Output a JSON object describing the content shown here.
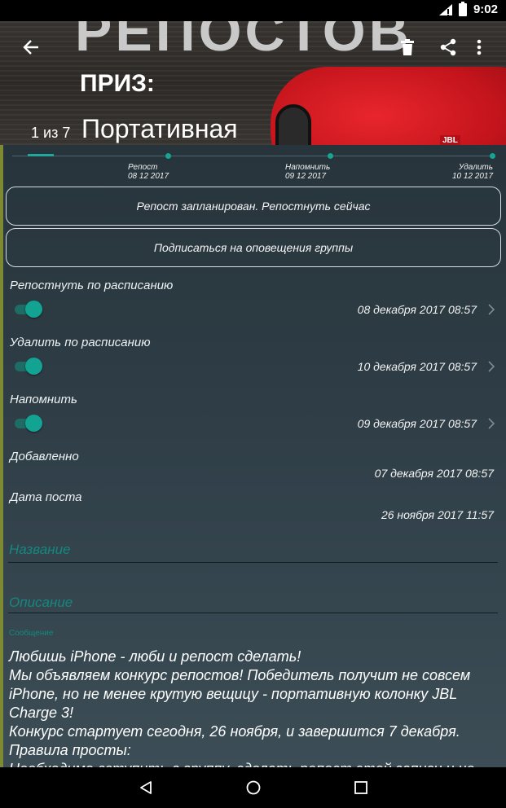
{
  "status_bar": {
    "time": "9:02"
  },
  "header": {
    "image_text_big": "РЕПОСТОВ",
    "image_text_prize": "ПРИЗ:",
    "image_text_sub": "Портативная",
    "counter": "1 из 7",
    "speaker_logo": "JBL",
    "icons": [
      "back-arrow-icon",
      "trash-icon",
      "share-icon",
      "more-vert-icon"
    ]
  },
  "timeline": {
    "progress": 0.05,
    "stages": [
      {
        "label": "Репост",
        "date": "08 12 2017"
      },
      {
        "label": "Напомнить",
        "date": "09 12 2017"
      },
      {
        "label": "Удалить",
        "date": "10 12 2017"
      }
    ]
  },
  "buttons": {
    "repost_now": "Репост запланирован. Репостнуть сейчас",
    "subscribe": "Подписаться на оповещения группы"
  },
  "schedule": {
    "repost": {
      "label": "Репостнуть по расписанию",
      "enabled": true,
      "value": "08 декабря 2017 08:57"
    },
    "delete": {
      "label": "Удалить по расписанию",
      "enabled": true,
      "value": "10 декабря 2017 08:57"
    },
    "remind": {
      "label": "Напомнить",
      "enabled": true,
      "value": "09 декабря 2017 08:57"
    }
  },
  "info": {
    "added_label": "Добавленно",
    "added_value": "07 декабря 2017 08:57",
    "post_date_label": "Дата поста",
    "post_date_value": "26 ноября 2017 11:57"
  },
  "fields": {
    "name_label": "Название",
    "description_label": "Описание",
    "message_label": "Сообщение",
    "message_lines": [
      "Любишь iPhone - люби и репост сделать!",
      "Мы объявляем конкурс репостов! Победитель получит не совсем iPhone, но не менее крутую вещицу - портативную колонку JBL Charge 3!",
      "Конкурс стартует сегодня, 26 ноября, и завершится 7 декабря.",
      "Правила просты:",
      "Необходимо вступить в группу, сделать репост этой записи и не"
    ]
  },
  "colors": {
    "accent": "#14887f",
    "toggle_on": "#12a393",
    "left_accent": "#7d8a32"
  }
}
